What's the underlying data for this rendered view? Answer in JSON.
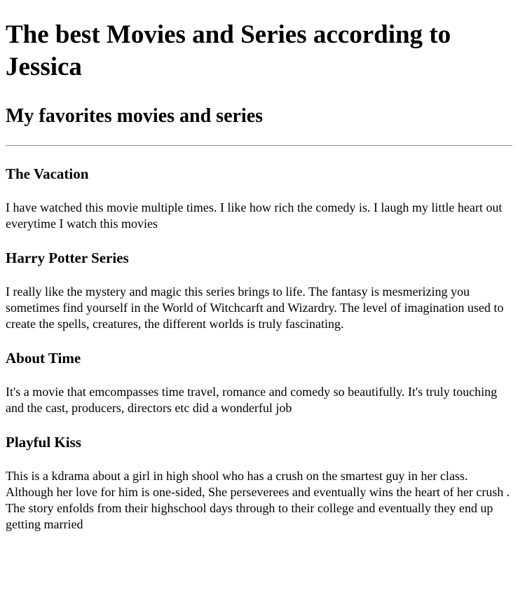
{
  "page": {
    "title": "The best Movies and Series according to Jessica",
    "subtitle": "My favorites movies and series"
  },
  "entries": [
    {
      "title": "The Vacation",
      "text": "I have watched this movie multiple times. I like how rich the comedy is. I laugh my little heart out everytime I watch this movies"
    },
    {
      "title": "Harry Potter Series",
      "text": "I really like the mystery and magic this series brings to life. The fantasy is mesmerizing you sometimes find yourself in the World of Witchcarft and Wizardry. The level of imagination used to create the spells, creatures, the different worlds is truly fascinating."
    },
    {
      "title": "About Time",
      "text": "It's a movie that emcompasses time travel, romance and comedy so beautifully. It's truly touching and the cast, producers, directors etc did a wonderful job"
    },
    {
      "title": "Playful Kiss",
      "text": "This is a kdrama about a girl in high shool who has a crush on the smartest guy in her class. Although her love for him is one-sided, She perseverees and eventually wins the heart of her crush . The story enfolds from their highschool days through to their college and eventually they end up getting married"
    }
  ]
}
